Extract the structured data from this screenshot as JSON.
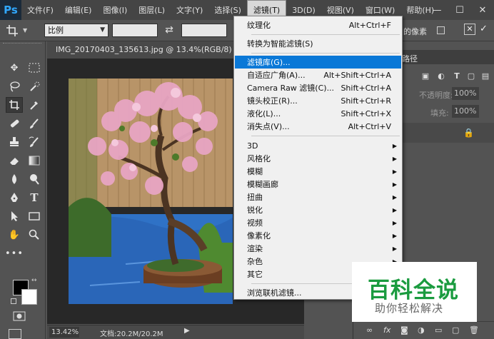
{
  "app": {
    "logo": "Ps"
  },
  "menubar": {
    "items": [
      {
        "label": "文件(F)"
      },
      {
        "label": "编辑(E)"
      },
      {
        "label": "图像(I)"
      },
      {
        "label": "图层(L)"
      },
      {
        "label": "文字(Y)"
      },
      {
        "label": "选择(S)"
      },
      {
        "label": "滤镜(T)",
        "active": true
      },
      {
        "label": "3D(D)"
      },
      {
        "label": "视图(V)"
      },
      {
        "label": "窗口(W)"
      },
      {
        "label": "帮助(H)"
      }
    ]
  },
  "window_controls": {
    "minimize": "—",
    "maximize": "☐",
    "close": "✕"
  },
  "options": {
    "ratio": "比例",
    "right_text": "的像素",
    "close_glyph": "✕",
    "commit_glyph": "✓"
  },
  "document": {
    "tab_title": "IMG_20170403_135613.jpg @ 13.4%(RGB/8) *",
    "zoom": "13.42%",
    "doc_size": "文档:20.2M/20.2M",
    "status_arrow": "▶"
  },
  "panels": {
    "tab_label": "路径",
    "opacity_label": "不透明度:",
    "opacity_value": "100%",
    "fill_label": "填充:",
    "fill_value": "100%"
  },
  "filter_menu": {
    "items": [
      {
        "label": "纹理化",
        "shortcut": "Alt+Ctrl+F"
      },
      {
        "label": "转换为智能滤镜(S)",
        "shortcut": ""
      },
      {
        "label": "滤镜库(G)...",
        "shortcut": "",
        "highlighted": true
      },
      {
        "label": "自适应广角(A)...",
        "shortcut": "Alt+Shift+Ctrl+A"
      },
      {
        "label": "Camera Raw 滤镜(C)...",
        "shortcut": "Shift+Ctrl+A"
      },
      {
        "label": "镜头校正(R)...",
        "shortcut": "Shift+Ctrl+R"
      },
      {
        "label": "液化(L)...",
        "shortcut": "Shift+Ctrl+X"
      },
      {
        "label": "消失点(V)...",
        "shortcut": "Alt+Ctrl+V"
      },
      {
        "label": "3D",
        "submenu": true
      },
      {
        "label": "风格化",
        "submenu": true
      },
      {
        "label": "模糊",
        "submenu": true
      },
      {
        "label": "模糊画廊",
        "submenu": true
      },
      {
        "label": "扭曲",
        "submenu": true
      },
      {
        "label": "锐化",
        "submenu": true
      },
      {
        "label": "视频",
        "submenu": true
      },
      {
        "label": "像素化",
        "submenu": true
      },
      {
        "label": "渲染",
        "submenu": true
      },
      {
        "label": "杂色",
        "submenu": true
      },
      {
        "label": "其它",
        "submenu": true
      },
      {
        "label": "浏览联机滤镜...",
        "shortcut": ""
      }
    ]
  },
  "watermark": {
    "title": "百科全说",
    "subtitle": "助你轻松解决"
  },
  "colors": {
    "menubar_bg": "#454545",
    "workspace_bg": "#535353",
    "menu_highlight": "#0a78d7",
    "watermark_green": "#1a9b3f",
    "foreground": "#000000",
    "background": "#ffffff"
  },
  "toolbox_icons": [
    "move-icon",
    "marquee-icon",
    "lasso-icon",
    "quick-select-icon",
    "crop-icon",
    "eyedropper-icon",
    "healing-icon",
    "brush-icon",
    "stamp-icon",
    "history-brush-icon",
    "eraser-icon",
    "gradient-icon",
    "blur-icon",
    "dodge-icon",
    "pen-icon",
    "type-icon",
    "path-select-icon",
    "rectangle-icon",
    "hand-icon",
    "zoom-icon",
    "more-tools-icon"
  ]
}
